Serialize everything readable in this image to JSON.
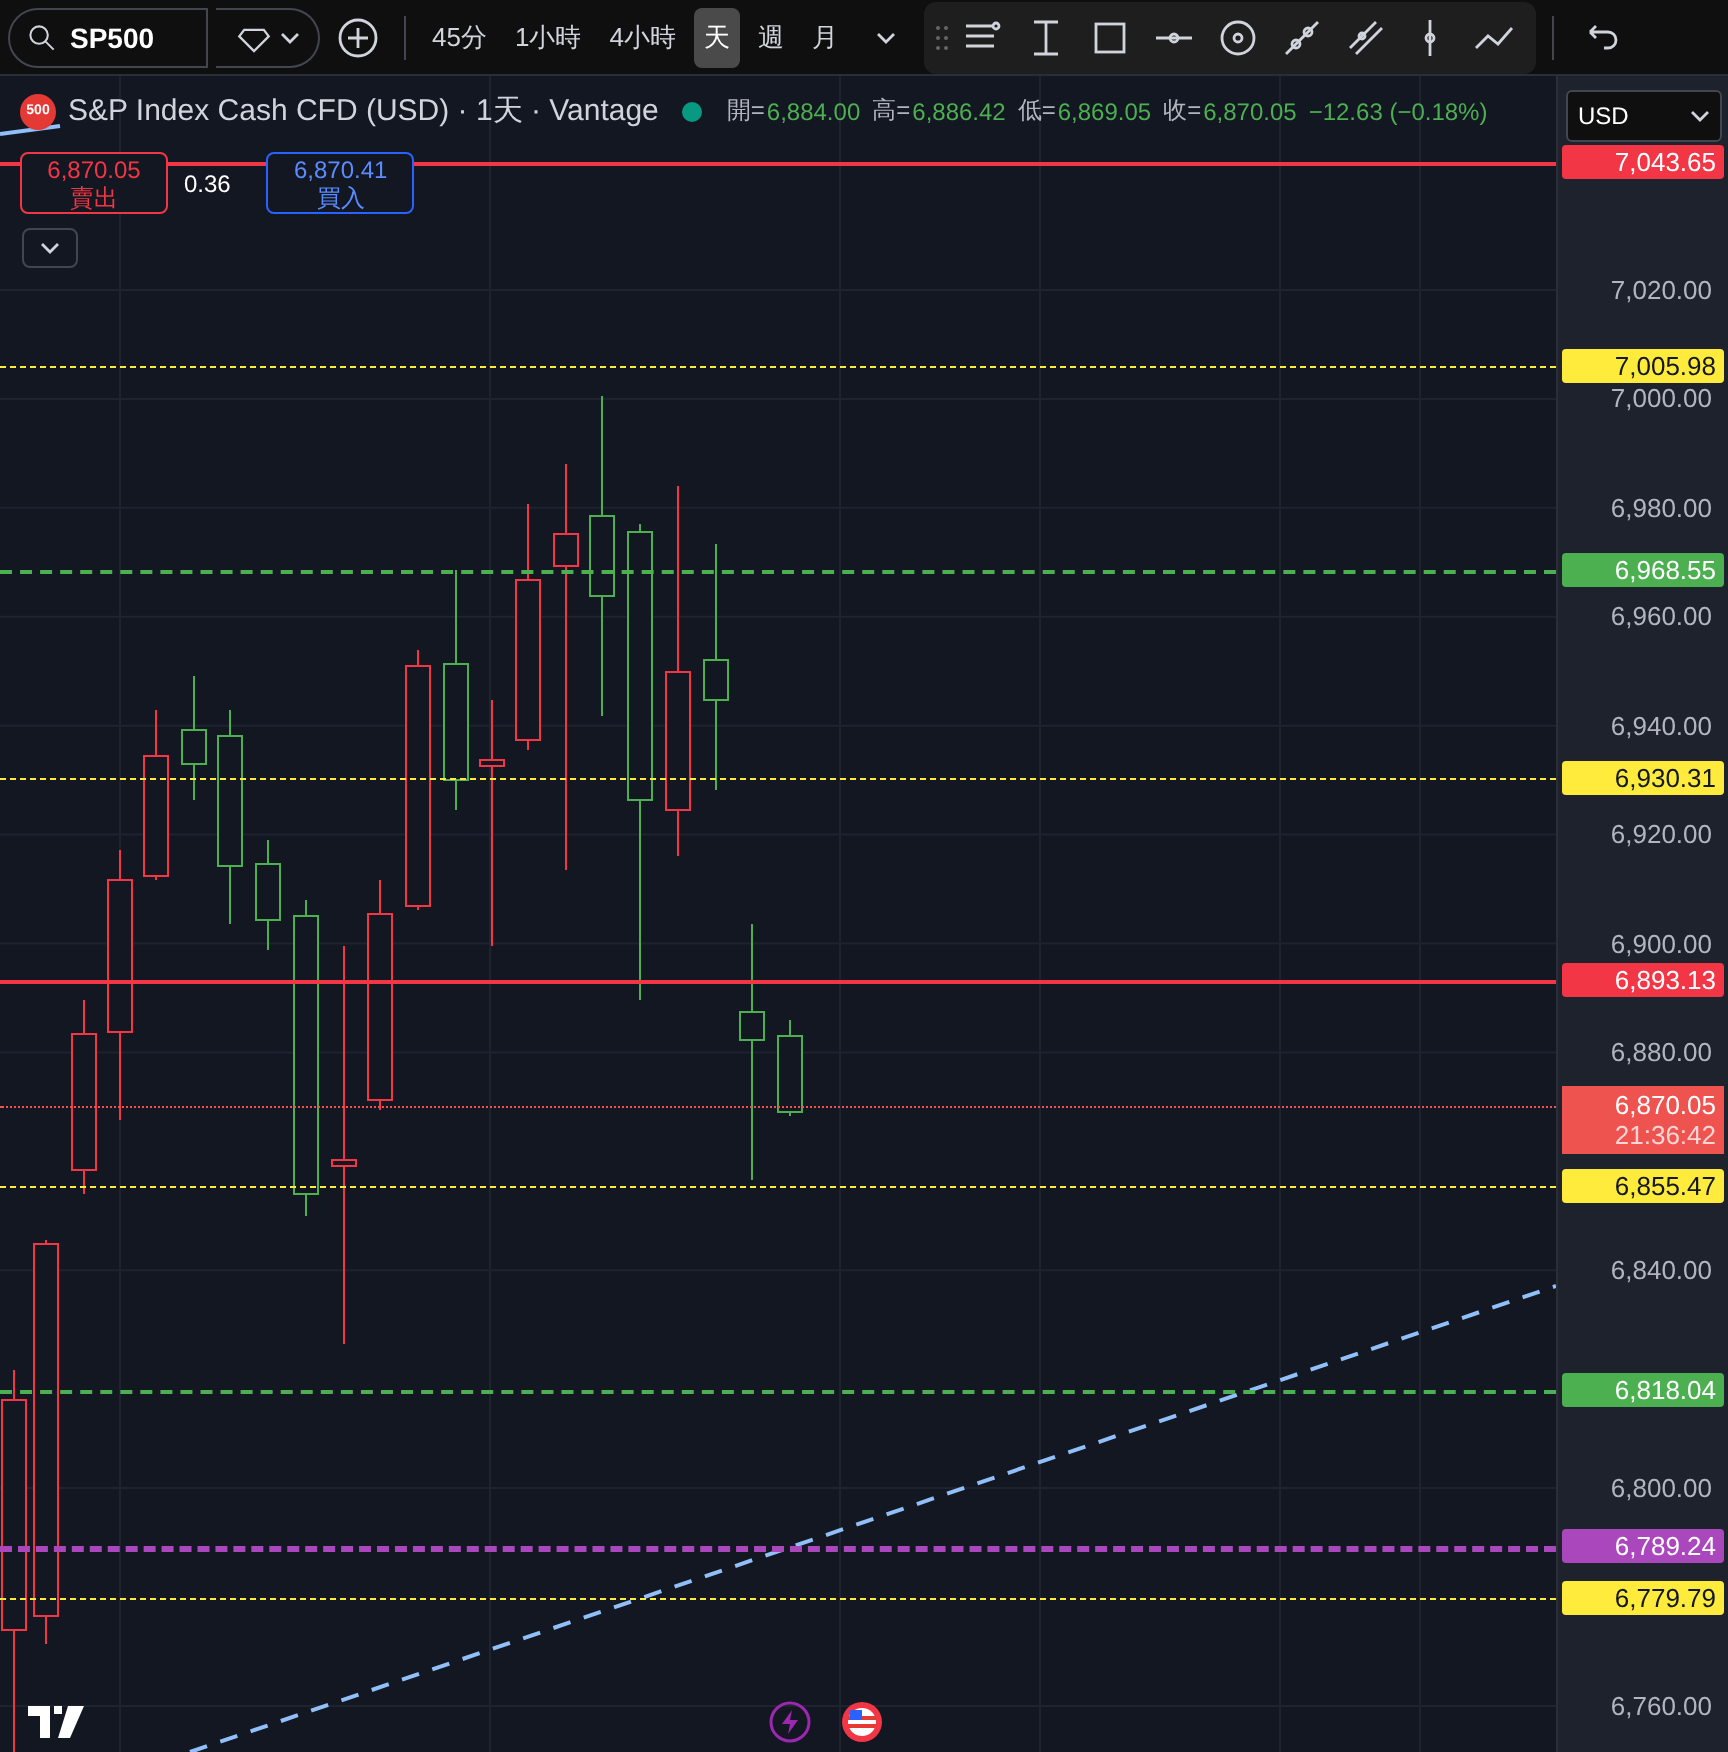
{
  "toolbar": {
    "symbol": "SP500",
    "intervals": [
      {
        "label": "45分",
        "selected": false
      },
      {
        "label": "1小時",
        "selected": false
      },
      {
        "label": "4小時",
        "selected": false
      },
      {
        "label": "天",
        "selected": true
      },
      {
        "label": "週",
        "selected": false
      },
      {
        "label": "月",
        "selected": false
      }
    ]
  },
  "legend": {
    "logo": "500",
    "title": "S&P Index Cash CFD (USD) · 1天 · Vantage",
    "ohlc": [
      {
        "label": "開=",
        "value": "6,884.00"
      },
      {
        "label": "高=",
        "value": "6,886.42"
      },
      {
        "label": "低=",
        "value": "6,869.05"
      },
      {
        "label": "收=",
        "value": "6,870.05"
      }
    ],
    "change": "−12.63 (−0.18%)"
  },
  "trade": {
    "sell": {
      "price": "6,870.05",
      "label": "賣出"
    },
    "spread": "0.36",
    "buy": {
      "price": "6,870.41",
      "label": "買入"
    }
  },
  "currency": "USD",
  "price_axis": {
    "ticks": [
      "7,020.00",
      "7,000.00",
      "6,980.00",
      "6,960.00",
      "6,940.00",
      "6,920.00",
      "6,900.00",
      "6,880.00",
      "6,840.00",
      "6,800.00",
      "6,760.00"
    ]
  },
  "levels": [
    {
      "price": "7,043.65",
      "color": "#f23645",
      "kind": "solid"
    },
    {
      "price": "7,005.98",
      "color": "#ffeb3b",
      "kind": "dotted"
    },
    {
      "price": "6,968.55",
      "color": "#4caf50",
      "kind": "dashed"
    },
    {
      "price": "6,930.31",
      "color": "#ffeb3b",
      "kind": "dotted"
    },
    {
      "price": "6,893.13",
      "color": "#f23645",
      "kind": "solid"
    },
    {
      "price": "6,855.47",
      "color": "#ffeb3b",
      "kind": "dotted"
    },
    {
      "price": "6,818.04",
      "color": "#4caf50",
      "kind": "dashed"
    },
    {
      "price": "6,789.24",
      "color": "#ab47bc",
      "kind": "thick"
    },
    {
      "price": "6,779.79",
      "color": "#ffeb3b",
      "kind": "dotted"
    }
  ],
  "current": {
    "price": "6,870.05",
    "countdown": "21:36:42"
  }
}
